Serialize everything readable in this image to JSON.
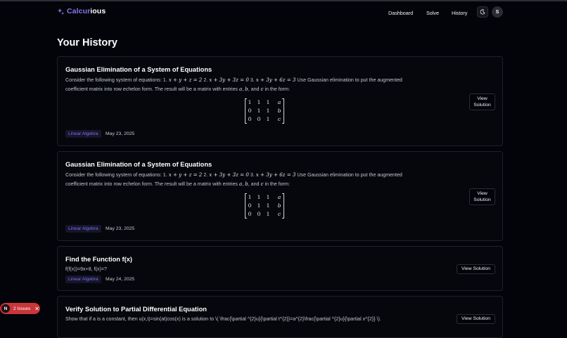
{
  "app": {
    "brand_part1": "Calcur",
    "brand_part2": "ious",
    "accent_color": "#8b73f0"
  },
  "nav": {
    "links": [
      "Dashboard",
      "Solve",
      "History"
    ],
    "theme_icon": "moon-icon",
    "avatar_initial": "S"
  },
  "page": {
    "title": "Your History"
  },
  "cards": [
    {
      "title": "Gaussian Elimination of a System of Equations",
      "desc_line1_a": "Consider the following system of equations: 1.",
      "desc_line1_math1": "x + y + z = 2",
      "desc_line1_b": "2.",
      "desc_line1_math2": "x + 3y + 3z = 0",
      "desc_line1_c": "3.",
      "desc_line1_math3": "x + 3y + 6z = 3",
      "desc_line1_d": "Use Gaussian elimination to put the augmented",
      "desc_line2_a": "coefficient matrix into row echelon form. The result will be a matrix with entries",
      "desc_line2_a_var": "a",
      "desc_line2_b_var": "b",
      "desc_line2_and": "and",
      "desc_line2_c_var": "c",
      "desc_line2_end": "in the form:",
      "matrix": [
        [
          "1",
          "1",
          "1",
          "a"
        ],
        [
          "0",
          "1",
          "1",
          "b"
        ],
        [
          "0",
          "0",
          "1",
          "c"
        ]
      ],
      "tag": "Linear Algebra",
      "date": "May 23, 2025",
      "button": "View Solution"
    },
    {
      "title": "Gaussian Elimination of a System of Equations",
      "desc_line1_a": "Consider the following system of equations: 1.",
      "desc_line1_math1": "x + y + z = 2",
      "desc_line1_b": "2.",
      "desc_line1_math2": "x + 3y + 3z = 0",
      "desc_line1_c": "3.",
      "desc_line1_math3": "x + 3y + 6z = 3",
      "desc_line1_d": "Use Gaussian elimination to put the augmented",
      "desc_line2_a": "coefficient matrix into row echelon form. The result will be a matrix with entries",
      "desc_line2_a_var": "a",
      "desc_line2_b_var": "b",
      "desc_line2_and": "and",
      "desc_line2_c_var": "c",
      "desc_line2_end": "in the form:",
      "matrix": [
        [
          "1",
          "1",
          "1",
          "a"
        ],
        [
          "0",
          "1",
          "1",
          "b"
        ],
        [
          "0",
          "0",
          "1",
          "c"
        ]
      ],
      "tag": "Linear Algebra",
      "date": "May 23, 2025",
      "button": "View Solution"
    },
    {
      "title": "Find the Function f(x)",
      "desc": "f(f(x))=9x+8, f(x)=?",
      "tag": "Linear Algebra",
      "date": "May 24, 2025",
      "button": "View Solution"
    },
    {
      "title": "Verify Solution to Partial Differential Equation",
      "desc": "Show that if a is a constant, then u(x,t)=sin(at)cos(x) is a solution to \\( \\frac{\\partial ^{2}u}{\\partial t^{2}}=a^{2}\\frac{\\partial ^{2}u}{\\partial x^{2}} \\).",
      "button": "View Solution"
    }
  ],
  "issues_badge": {
    "initial": "N",
    "label": "2 Issues",
    "close": "✕"
  }
}
